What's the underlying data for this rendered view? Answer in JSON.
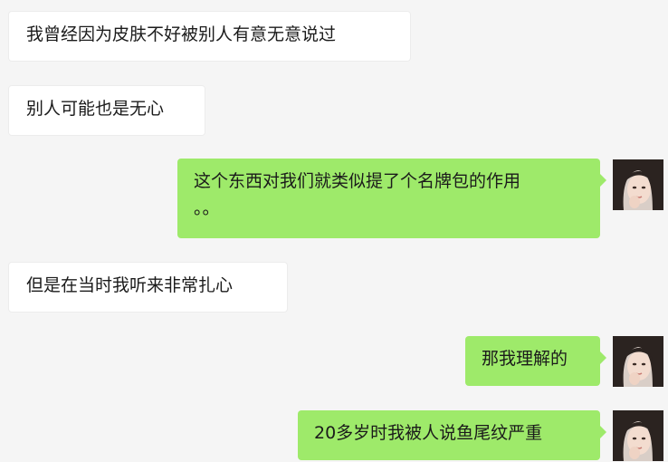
{
  "messages": [
    {
      "side": "left",
      "text": "我曾经因为皮肤不好被别人有意无意说过"
    },
    {
      "side": "left",
      "text": "别人可能也是无心"
    },
    {
      "side": "right",
      "line1": "这个东西对我们就类似提了个名牌包的作用",
      "line2": "。。"
    },
    {
      "side": "left",
      "text": "但是在当时我听来非常扎心"
    },
    {
      "side": "right",
      "text": "那我理解的"
    },
    {
      "side": "right",
      "text": "20多岁时我被人说鱼尾纹严重"
    }
  ],
  "colors": {
    "background": "#f5f5f5",
    "left_bubble": "#ffffff",
    "right_bubble": "#9eea6a"
  },
  "icons": {
    "avatar": "user-avatar-photo"
  }
}
